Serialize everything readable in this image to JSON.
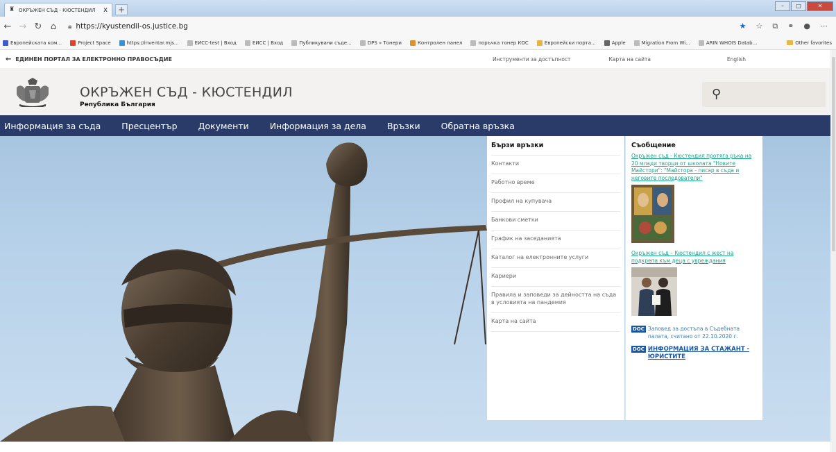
{
  "browser": {
    "tab_title": "ОКРЪЖЕН СЪД - КЮСТЕНДИЛ",
    "tab_close": "x",
    "new_tab": "+",
    "url": "https://kyustendil-os.justice.bg",
    "bookmarks": [
      {
        "label": "Европейската ком...",
        "color": "#3b5ccf"
      },
      {
        "label": "Project Space",
        "color": "#d9452f"
      },
      {
        "label": "https://inventar.mjs...",
        "color": "#3a8fd9"
      },
      {
        "label": "ЕИСС-test | Вход",
        "color": "#bbbbbb"
      },
      {
        "label": "ЕИСС | Вход",
        "color": "#bbbbbb"
      },
      {
        "label": "Публикувани съде...",
        "color": "#bbbbbb"
      },
      {
        "label": "DPS » Тонери",
        "color": "#bbbbbb"
      },
      {
        "label": "Контролен панел",
        "color": "#e0922a"
      },
      {
        "label": "поръчка тонер КОС",
        "color": "#bbbbbb"
      },
      {
        "label": "Европейски портa...",
        "color": "#e8b441"
      },
      {
        "label": "Apple",
        "color": "#666666"
      },
      {
        "label": "Migration From Wi...",
        "color": "#bbbbbb"
      },
      {
        "label": "ARIN WHOIS Datab...",
        "color": "#bbbbbb"
      }
    ],
    "other_favorites": "Other favorites"
  },
  "page": {
    "portal_link": "ЕДИНЕН ПОРТАЛ ЗА ЕЛЕКТРОННО ПРАВОСЪДИЕ",
    "top_links": [
      "Инструменти за достъпност",
      "Карта на сайта",
      "English"
    ],
    "site_title": "ОКРЪЖЕН СЪД - КЮСТЕНДИЛ",
    "site_subtitle": "Република България",
    "nav": [
      "Информация за съда",
      "Пресцентър",
      "Документи",
      "Информация за дела",
      "Връзки",
      "Обратна връзка"
    ],
    "quick_links_title": "Бързи връзки",
    "quick_links": [
      "Контакти",
      "Работно време",
      "Профил на купувача",
      "Банкови сметки",
      "График на заседанията",
      "Каталог на електронните услуги",
      "Кариери",
      "Правила и заповеди за дейността на съда в условията на пандемия",
      "Карта на сайта"
    ],
    "messages_title": "Съобщение",
    "message1": "Окръжен съд - Кюстендил протягa ръка на 20 млади творци от школата \"Новите Майстори\": \"Майстора - писар в съда и неговите последователи\"",
    "message2": "Окръжен съд – Кюстендил с жест на подкрепа към деца с увреждания",
    "doc_badge": "DOC",
    "doc1": "Заповед за достъпа в Съдебната палата, считано от 22.10.2020 г.",
    "doc2": "ИНФОРМАЦИЯ ЗА СТАЖАНТ - ЮРИСТИТЕ"
  }
}
